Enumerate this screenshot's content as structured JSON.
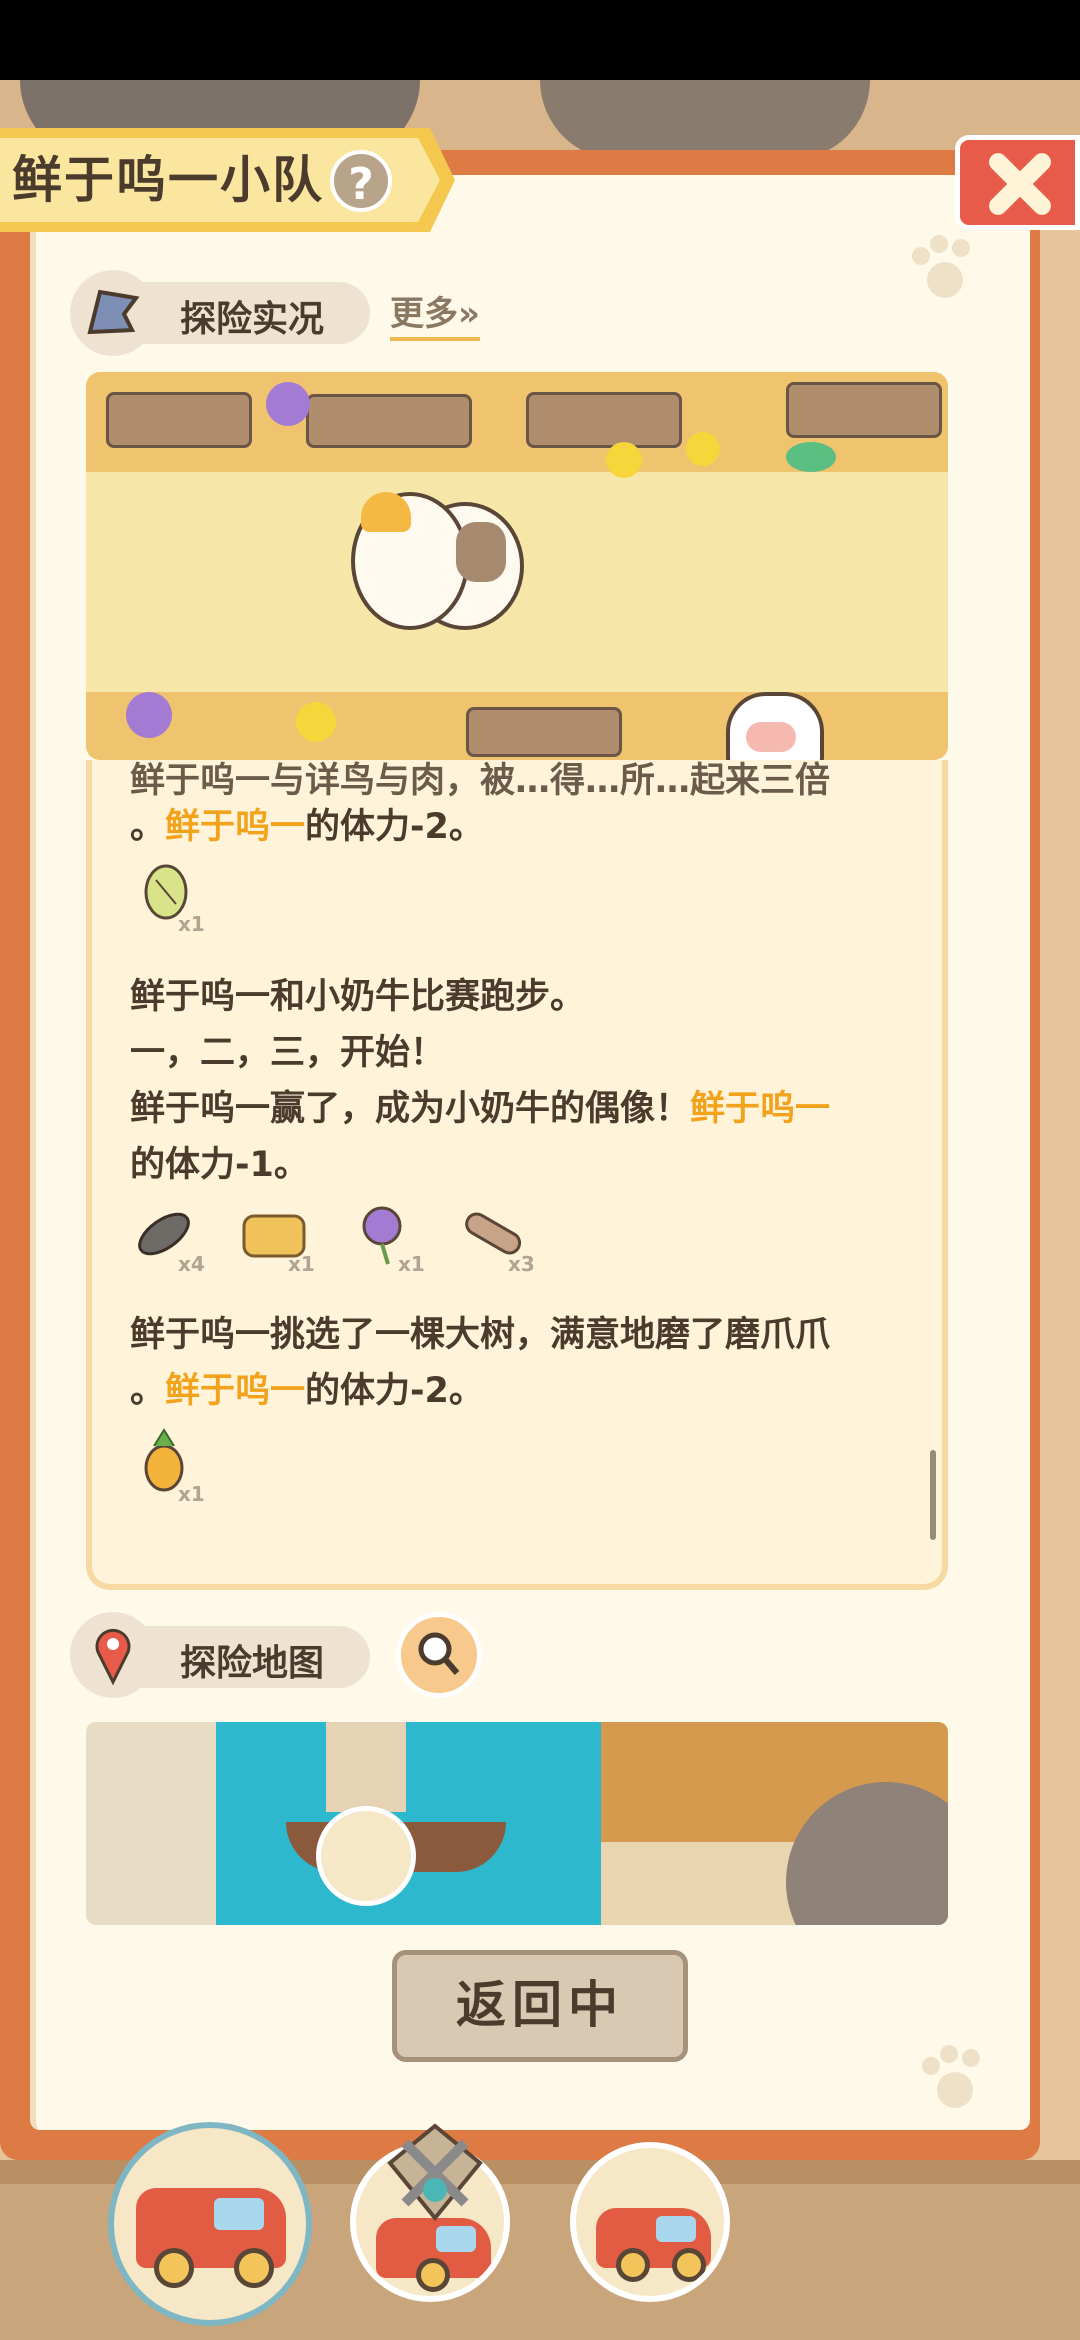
{
  "header": {
    "team_title": "鲜于呜一小队",
    "help_symbol": "?"
  },
  "live_section": {
    "title": "探险实况",
    "more_label": "更多»"
  },
  "log": {
    "line_partial": "鲜于呜一与详鸟与肉，被…得…所…起来三倍",
    "entries": [
      {
        "pre": "。",
        "name": "鲜于呜一",
        "post": "的体力-2。"
      },
      {
        "text1": "鲜于呜一和小奶牛比赛跑步。",
        "text2": "一，二，三，开始！",
        "text3": "鲜于呜一赢了，成为小奶牛的偶像！",
        "name": "鲜于呜一",
        "text4": "的体力-1。"
      },
      {
        "text1": "鲜于呜一挑选了一棵大树，满意地磨了磨爪爪",
        "pre": "。",
        "name": "鲜于呜一",
        "post": "的体力-2。"
      }
    ],
    "items": [
      {
        "icon": "cabbage-icon",
        "count": "x1"
      },
      {
        "icon": "fish-icon",
        "count": "x4"
      },
      {
        "icon": "hay-icon",
        "count": "x1"
      },
      {
        "icon": "flower-icon",
        "count": "x1"
      },
      {
        "icon": "wood-icon",
        "count": "x3"
      },
      {
        "icon": "pineapple-icon",
        "count": "x1"
      }
    ]
  },
  "map_section": {
    "title": "探险地图"
  },
  "return_button": "返回中",
  "colors": {
    "highlight": "#f2a21b",
    "text": "#4a3b2d",
    "cover": "#de7a44",
    "page": "#fff9ea"
  }
}
